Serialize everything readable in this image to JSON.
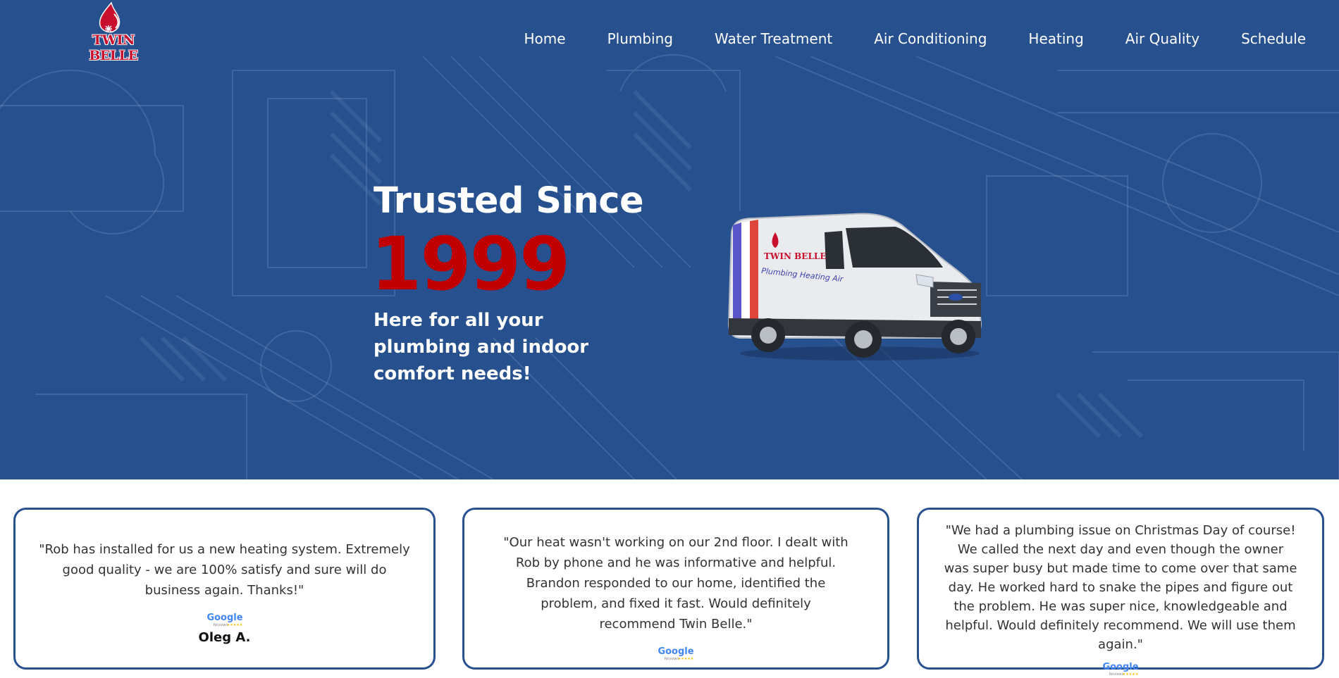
{
  "brand": {
    "logo_text": "TWIN BELLE",
    "primary": "#27508f",
    "accent": "#c00000"
  },
  "nav": {
    "items": [
      {
        "label": "Home"
      },
      {
        "label": "Plumbing"
      },
      {
        "label": "Water Treatment"
      },
      {
        "label": "Air Conditioning"
      },
      {
        "label": "Heating"
      },
      {
        "label": "Air Quality"
      },
      {
        "label": "Schedule"
      }
    ]
  },
  "hero": {
    "line1": "Trusted Since",
    "year": "1999",
    "subtitle": "Here for all your plumbing and indoor comfort needs!",
    "van_logo_text": "TWIN BELLE",
    "van_tagline": "Plumbing Heating Air"
  },
  "reviews": [
    {
      "quote": "\"Rob has installed for us a new heating system. Extremely good quality - we are 100% satisfy and sure will do business again. Thanks!\"",
      "source_icon": "google-reviews-icon",
      "name": "Oleg A."
    },
    {
      "quote": "\"Our heat wasn't working on our 2nd floor. I dealt with Rob by phone and he was informative and helpful. Brandon responded to our home, identified the problem, and fixed it fast. Would definitely recommend Twin Belle.\"",
      "source_icon": "google-reviews-icon",
      "name": ""
    },
    {
      "quote": "\"We had a plumbing issue on Christmas Day of course! We called the next day and even though the owner was super busy but made time to come over that same day. He worked hard to snake the pipes and figure out the problem. He was super nice, knowledgeable and helpful. Would definitely recommend. We will use them again.\"",
      "source_icon": "google-reviews-icon",
      "name": ""
    }
  ],
  "google_badge": {
    "label": "Google",
    "sub": "Reviews"
  }
}
